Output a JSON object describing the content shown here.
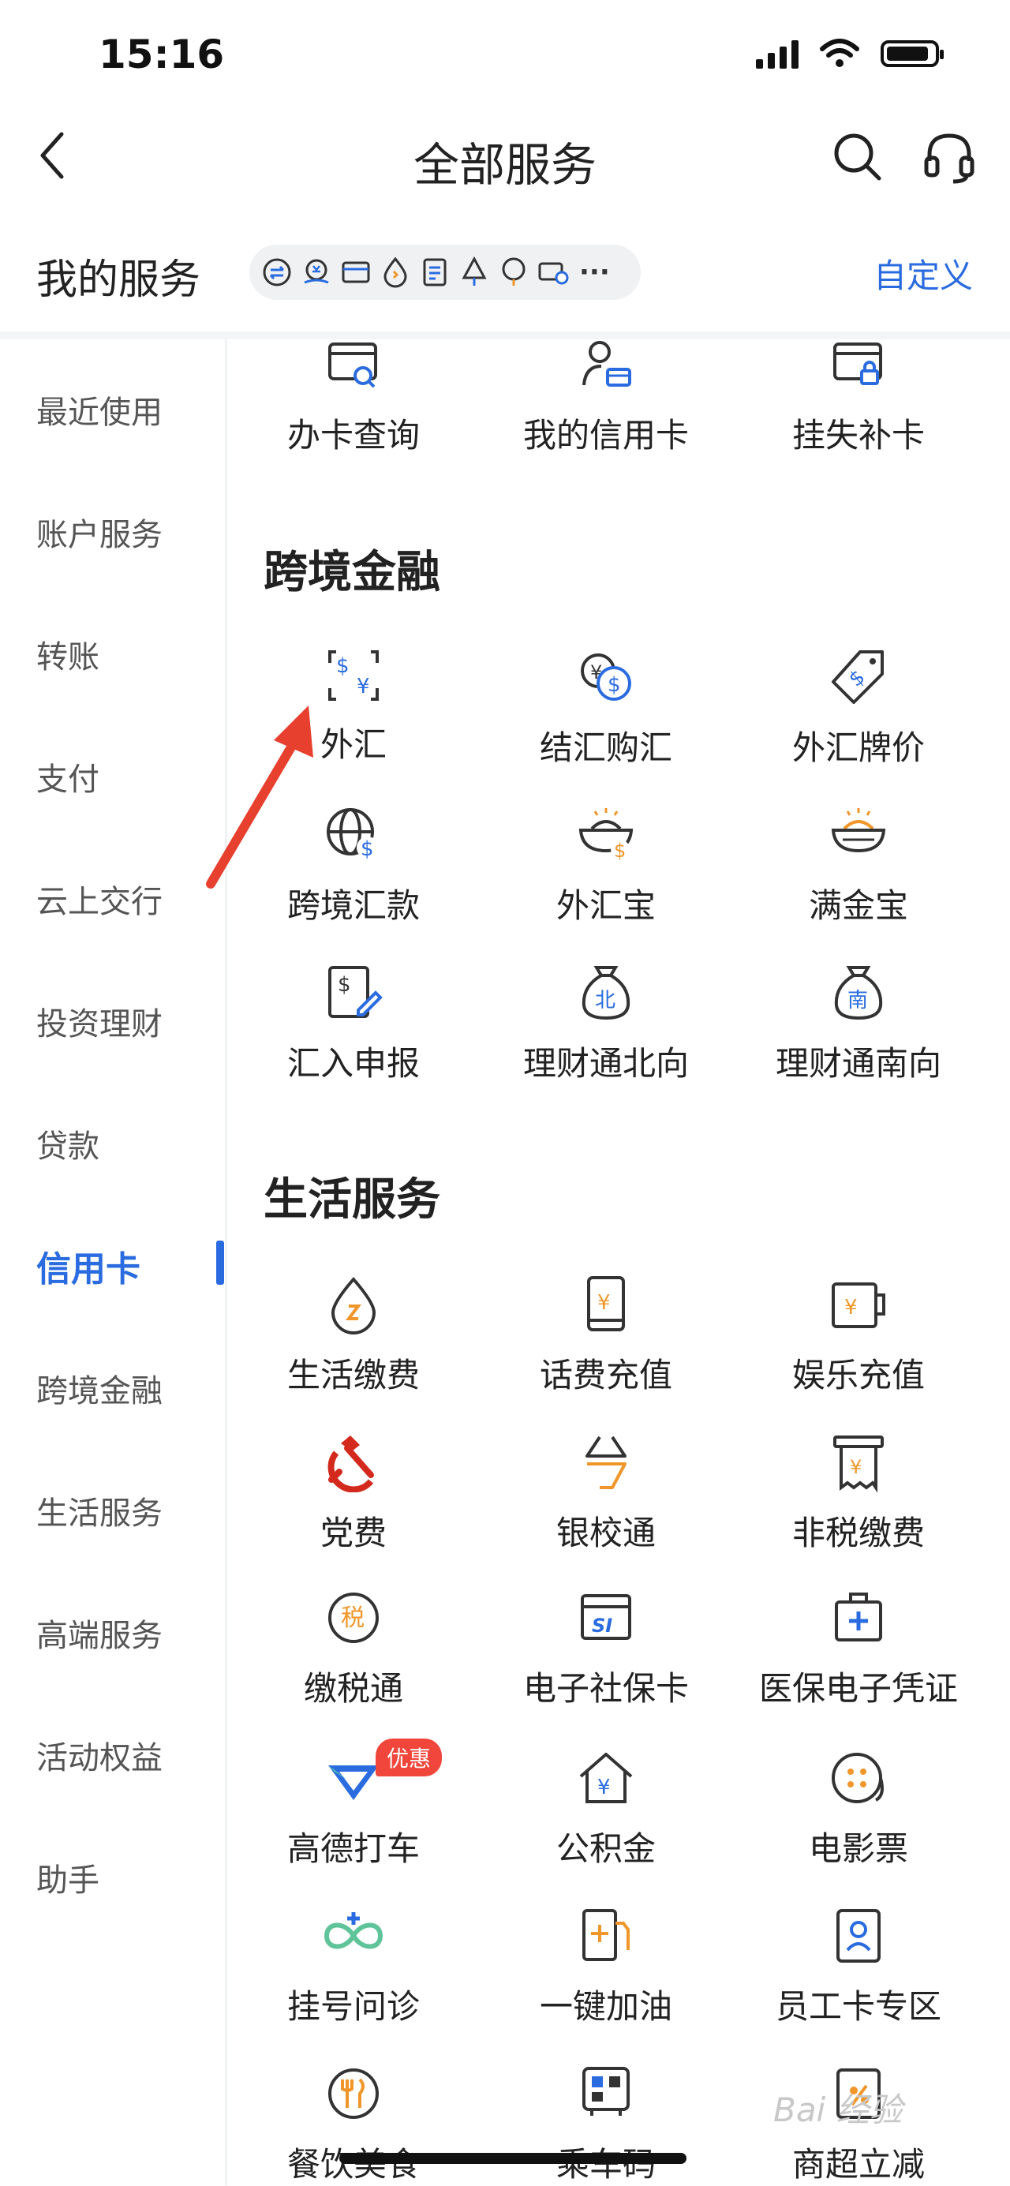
{
  "status_bar": {
    "time": "15:16"
  },
  "header": {
    "title": "全部服务"
  },
  "my_services": {
    "title": "我的服务",
    "customize": "自定义",
    "more": "···"
  },
  "sidebar": {
    "items": [
      {
        "label": "最近使用"
      },
      {
        "label": "账户服务"
      },
      {
        "label": "转账"
      },
      {
        "label": "支付"
      },
      {
        "label": "云上交行"
      },
      {
        "label": "投资理财"
      },
      {
        "label": "贷款"
      },
      {
        "label": "信用卡"
      },
      {
        "label": "跨境金融"
      },
      {
        "label": "生活服务"
      },
      {
        "label": "高端服务"
      },
      {
        "label": "活动权益"
      },
      {
        "label": "助手"
      }
    ],
    "active": "信用卡"
  },
  "credit_card": {
    "items": [
      {
        "label": "办卡查询"
      },
      {
        "label": "我的信用卡"
      },
      {
        "label": "挂失补卡"
      }
    ]
  },
  "cross_border": {
    "title": "跨境金融",
    "items": [
      {
        "label": "外汇"
      },
      {
        "label": "结汇购汇"
      },
      {
        "label": "外汇牌价"
      },
      {
        "label": "跨境汇款"
      },
      {
        "label": "外汇宝"
      },
      {
        "label": "满金宝"
      },
      {
        "label": "汇入申报"
      },
      {
        "label": "理财通北向"
      },
      {
        "label": "理财通南向"
      }
    ],
    "glyph_north": "北",
    "glyph_south": "南"
  },
  "life_services": {
    "title": "生活服务",
    "items": [
      {
        "label": "生活缴费"
      },
      {
        "label": "话费充值"
      },
      {
        "label": "娱乐充值"
      },
      {
        "label": "党费"
      },
      {
        "label": "银校通"
      },
      {
        "label": "非税缴费"
      },
      {
        "label": "缴税通"
      },
      {
        "label": "电子社保卡"
      },
      {
        "label": "医保电子凭证"
      },
      {
        "label": "高德打车",
        "badge": "优惠"
      },
      {
        "label": "公积金"
      },
      {
        "label": "电影票"
      },
      {
        "label": "挂号问诊"
      },
      {
        "label": "一键加油"
      },
      {
        "label": "员工卡专区"
      },
      {
        "label": "餐饮美食"
      },
      {
        "label": "乘车码"
      },
      {
        "label": "商超立减"
      }
    ],
    "glyph_tax": "税",
    "glyph_si": "SI"
  },
  "watermark": "Bai 经验",
  "colors": {
    "accent": "#2a6ce0",
    "orange": "#f0962a",
    "arrow": "#e8402f"
  }
}
